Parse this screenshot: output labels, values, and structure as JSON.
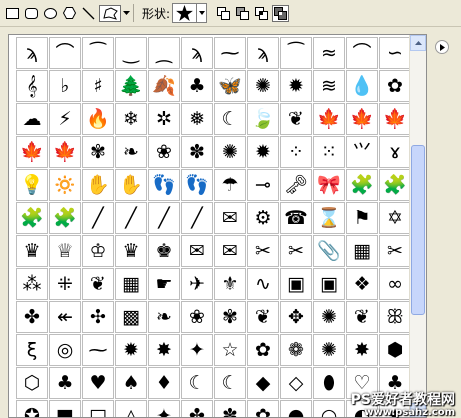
{
  "toolbar": {
    "shape_label": "形状:",
    "tools": [
      {
        "name": "rectangle-tool",
        "icon": "rectangle-icon"
      },
      {
        "name": "rounded-rectangle-tool",
        "icon": "rounded-rectangle-icon"
      },
      {
        "name": "ellipse-tool",
        "icon": "ellipse-icon"
      },
      {
        "name": "polygon-tool",
        "icon": "polygon-icon"
      },
      {
        "name": "line-tool",
        "icon": "line-icon"
      },
      {
        "name": "custom-shape-tool",
        "icon": "custom-shape-icon",
        "selected": true
      }
    ],
    "current_shape": "star-icon",
    "path_modes": [
      "add-to-shape-area-icon",
      "subtract-from-shape-area-icon",
      "intersect-shape-areas-icon",
      "exclude-overlapping-shape-areas-icon"
    ]
  },
  "shapes_panel": {
    "rows": [
      [
        "ϡ",
        "⌒",
        "⁀",
        "‿",
        "⁔",
        "ϡ",
        "⁓",
        "ϡ",
        "⁀",
        "≈",
        "⌒",
        "∽"
      ],
      [
        "𝄞",
        "♭",
        "♯",
        "🌲",
        "🍂",
        "♣",
        "🦋",
        "✺",
        "✹",
        "≋",
        "💧",
        "✿"
      ],
      [
        "☁",
        "⚡",
        "🔥",
        "❄",
        "✲",
        "❅",
        "☾",
        "🍃",
        "❦",
        "🍁",
        "🍁",
        "🍁"
      ],
      [
        "🍁",
        "🍁",
        "✾",
        "❧",
        "❀",
        "✽",
        "✺",
        "✹",
        "⁘",
        "⁙",
        "⺍",
        "ɤ"
      ],
      [
        "💡",
        "🔅",
        "✋",
        "✋",
        "👣",
        "👣",
        "☂",
        "⊸",
        "🗝",
        "🎀",
        "🧩",
        "🧩"
      ],
      [
        "🧩",
        "🧩",
        "╱",
        "╱",
        "╱",
        "╱",
        "✉",
        "⚙",
        "☎",
        "⌛",
        "⚑",
        "✡"
      ],
      [
        "♛",
        "♕",
        "♔",
        "♛",
        "♚",
        "✉",
        "✉",
        "✂",
        "✂",
        "📎",
        "▦",
        "✂"
      ],
      [
        "⁂",
        "⁜",
        "❦",
        "▦",
        "☛",
        "✈",
        "⚜",
        "∿",
        "▣",
        "▣",
        "❖",
        "∞"
      ],
      [
        "✤",
        "↞",
        "✣",
        "▩",
        "❧",
        "❀",
        "✾",
        "❦",
        "✥",
        "✺",
        "❦",
        "ꕥ"
      ],
      [
        "ξ",
        "◎",
        "⁓",
        "✹",
        "✸",
        "✦",
        "☆",
        "✿",
        "❁",
        "✺",
        "✸",
        "⬢"
      ],
      [
        "⬡",
        "♣",
        "♥",
        "♠",
        "♦",
        "☾",
        "☾",
        "◆",
        "◇",
        "⬮",
        "♡",
        "♣"
      ],
      [
        "✪",
        "■",
        "□",
        "△",
        "✦",
        "✤",
        "✽",
        "✿",
        "●",
        "○",
        "◐",
        "★"
      ]
    ]
  },
  "watermark": {
    "line1": "PS爱好者教程网",
    "line2": "www.psahz.com"
  }
}
